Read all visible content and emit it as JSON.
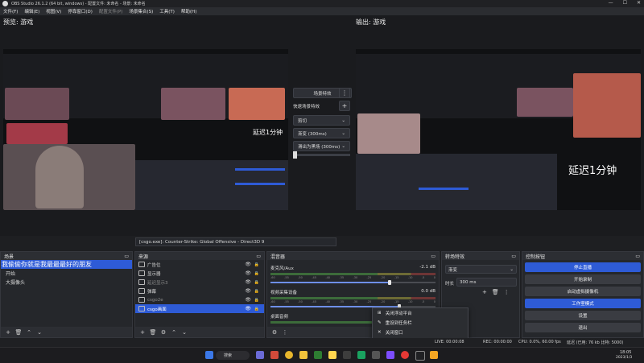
{
  "window": {
    "title": "OBS Studio 26.1.2 (64 bit, windows) - 配置文件: 未命名 - 场景: 未命名",
    "controls": [
      "—",
      "☐",
      "✕"
    ]
  },
  "menu": [
    {
      "label": "文件(F)"
    },
    {
      "label": "编辑(E)"
    },
    {
      "label": "视图(V)"
    },
    {
      "label": "停靠窗口(D)"
    },
    {
      "label": "配置文件(P)",
      "disabled": true
    },
    {
      "label": "场景集合(S)"
    },
    {
      "label": "工具(T)"
    },
    {
      "label": "帮助(H)"
    }
  ],
  "preview": {
    "label": "预览: 游戏",
    "overlay_text": "延迟1分钟"
  },
  "program": {
    "label": "输出: 游戏",
    "overlay_text": "延迟1分钟"
  },
  "transition_panel": {
    "studio_btn": "场景特效",
    "quick_label": "快速场景特效",
    "cut": "剪切",
    "fade": "渐变 (300ms)",
    "swipe": "滑出为黑场 (300ms)",
    "more_glyph": "⋮",
    "add_glyph": "+"
  },
  "source_bar": {
    "text": "[csgo.exe]: Counter-Strike: Global Offensive - Direct3D 9"
  },
  "scenes": {
    "title": "场景",
    "items": [
      {
        "label": "我偷偷你就是我最最最好的朋友",
        "selected": true
      },
      {
        "label": "开始",
        "selected": false
      },
      {
        "label": "大摄像头",
        "selected": false
      }
    ]
  },
  "sources": {
    "title": "来源",
    "items": [
      {
        "label": "广告位",
        "selected": false
      },
      {
        "label": "显示器",
        "selected": false
      },
      {
        "label": "延迟显示3",
        "selected": false,
        "hidden": true
      },
      {
        "label": "弹幕",
        "selected": false
      },
      {
        "label": "csgo2e",
        "selected": false,
        "hidden": true
      },
      {
        "label": "csgo画面",
        "selected": true
      }
    ]
  },
  "mixer": {
    "title": "混音器",
    "channels": [
      {
        "name": "麦克风/Aux",
        "db": "-2.1 dB",
        "level": 0.72
      },
      {
        "name": "视频采集设备",
        "db": "0.0 dB",
        "level": 0.78
      },
      {
        "name": "桌面音频",
        "db": "",
        "level": 0.6
      }
    ],
    "ticks": [
      "-60",
      "-55",
      "-50",
      "-45",
      "-40",
      "-35",
      "-30",
      "-25",
      "-20",
      "-15",
      "-10",
      "-5",
      "0"
    ]
  },
  "transitions": {
    "title": "转场特效",
    "type_value": "渐变",
    "duration_label": "时长",
    "duration_value": "300 ms"
  },
  "controls": {
    "title": "控制按钮",
    "buttons": [
      {
        "label": "停止直播",
        "active": true
      },
      {
        "label": "开始录制",
        "active": false
      },
      {
        "label": "启动虚拟摄像机",
        "active": false
      },
      {
        "label": "工作室模式",
        "active": true
      },
      {
        "label": "设置",
        "active": false
      },
      {
        "label": "退出",
        "active": false
      }
    ]
  },
  "context_menu": {
    "items": [
      {
        "icon": "⊞",
        "label": "关闭浮动平台"
      },
      {
        "icon": "✎",
        "label": "重设到任务栏"
      },
      {
        "icon": "✕",
        "label": "关闭窗口"
      }
    ]
  },
  "statusbar": {
    "live": "LIVE: 00:00:08",
    "rec": "REC: 00:00:00",
    "cpu": "CPU: 0.0%, 60.00 fps",
    "kbps": "延迟 (已用: 76 kb 比特: 5000)"
  },
  "taskbar": {
    "search": "搜索",
    "time": "18:05",
    "date": "2023/1/3"
  },
  "colors": {
    "accent": "#2e5bd6",
    "panel": "#25272b",
    "background": "#1e1f22"
  }
}
